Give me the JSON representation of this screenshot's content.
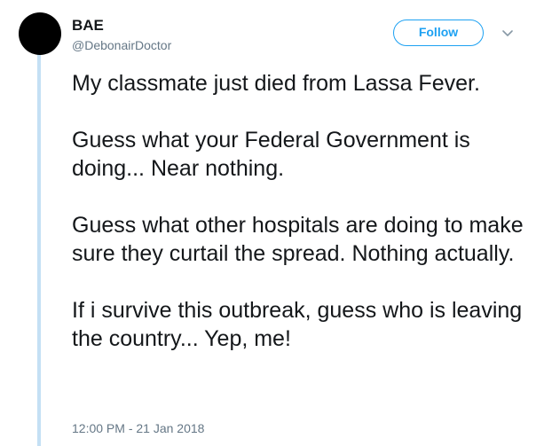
{
  "tweet": {
    "display_name": "BAE",
    "handle": "@DebonairDoctor",
    "follow_label": "Follow",
    "paragraphs": [
      "My classmate just died from Lassa Fever.",
      "Guess what your Federal Government is doing... Near nothing.",
      "Guess what other hospitals are doing to make sure they curtail the spread. Nothing actually.",
      "If i survive this outbreak, guess who is leaving the country... Yep, me!"
    ],
    "timestamp": "12:00 PM - 21 Jan 2018"
  },
  "colors": {
    "accent": "#1da1f2",
    "thread_line": "#c4e0f4",
    "secondary_text": "#657786",
    "primary_text": "#14171a"
  },
  "icons": {
    "menu": "chevron-down-icon"
  }
}
